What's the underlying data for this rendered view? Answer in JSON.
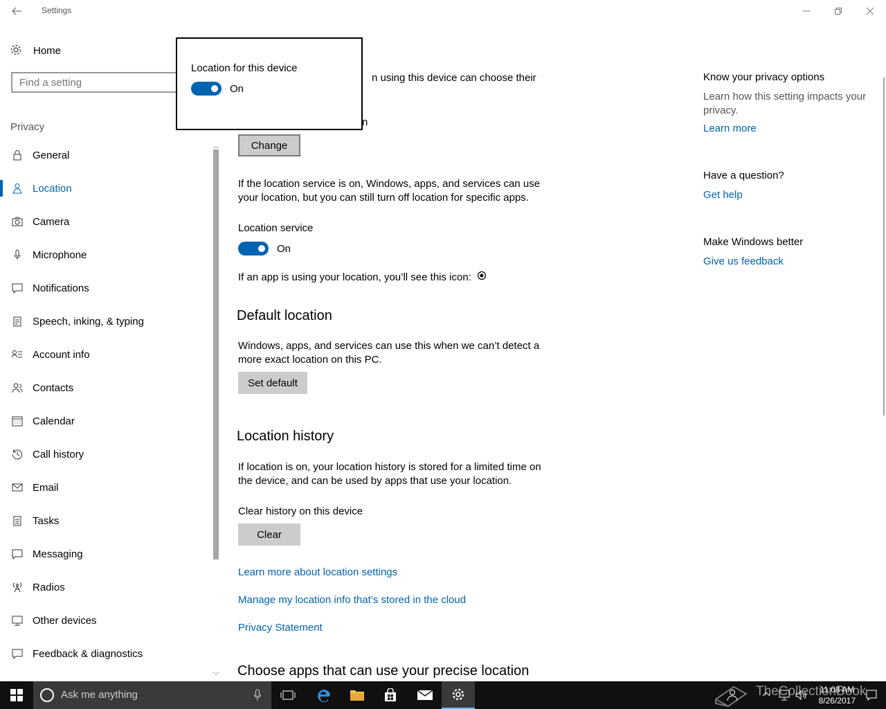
{
  "window": {
    "title": "Settings"
  },
  "nav": {
    "home_label": "Home",
    "search_placeholder": "Find a setting",
    "section_label": "Privacy",
    "items": [
      {
        "label": "General",
        "icon": "lock-icon"
      },
      {
        "label": "Location",
        "icon": "location-person-icon",
        "active": true
      },
      {
        "label": "Camera",
        "icon": "camera-icon"
      },
      {
        "label": "Microphone",
        "icon": "microphone-icon"
      },
      {
        "label": "Notifications",
        "icon": "notification-icon"
      },
      {
        "label": "Speech, inking, & typing",
        "icon": "clipboard-icon"
      },
      {
        "label": "Account info",
        "icon": "account-info-icon"
      },
      {
        "label": "Contacts",
        "icon": "contacts-icon"
      },
      {
        "label": "Calendar",
        "icon": "calendar-icon"
      },
      {
        "label": "Call history",
        "icon": "history-icon"
      },
      {
        "label": "Email",
        "icon": "mail-icon"
      },
      {
        "label": "Tasks",
        "icon": "tasks-icon"
      },
      {
        "label": "Messaging",
        "icon": "message-icon"
      },
      {
        "label": "Radios",
        "icon": "radio-tower-icon"
      },
      {
        "label": "Other devices",
        "icon": "devices-icon"
      },
      {
        "label": "Feedback & diagnostics",
        "icon": "feedback-icon"
      }
    ]
  },
  "popup": {
    "title": "Location for this device",
    "toggle_state": "On"
  },
  "main": {
    "partial_line1": "n using this device can choose their",
    "partial_line2": "n",
    "change_button": "Change",
    "service_desc_line1": "If the location service is on, Windows, apps, and services can use",
    "service_desc_line2": "your location, but you can still turn off location for specific apps.",
    "service_label": "Location service",
    "service_toggle": "On",
    "icon_notice": "If an app is using your location, you’ll see this icon:",
    "default_heading": "Default location",
    "default_desc_line1": "Windows, apps, and services can use this when we can’t detect a",
    "default_desc_line2": "more exact location on this PC.",
    "set_default_button": "Set default",
    "history_heading": "Location history",
    "history_desc_line1": "If location is on, your location history is stored for a limited time on",
    "history_desc_line2": "the device, and can be used by apps that use your location.",
    "clear_label": "Clear history on this device",
    "clear_button": "Clear",
    "link_learn_more": "Learn more about location settings",
    "link_manage": "Manage my location info that’s stored in the cloud",
    "link_privacy": "Privacy Statement",
    "apps_heading": "Choose apps that can use your precise location"
  },
  "right": {
    "privacy_heading": "Know your privacy options",
    "privacy_desc": "Learn how this setting impacts your privacy.",
    "privacy_link": "Learn more",
    "question_heading": "Have a question?",
    "question_link": "Get help",
    "better_heading": "Make Windows better",
    "better_link": "Give us feedback"
  },
  "taskbar": {
    "search_placeholder": "Ask me anything",
    "time": "11:08 AM",
    "date": "8/26/2017",
    "watermark": "TheCollectionBook"
  },
  "colors": {
    "accent": "#0063b1",
    "taskbar": "#101010"
  }
}
